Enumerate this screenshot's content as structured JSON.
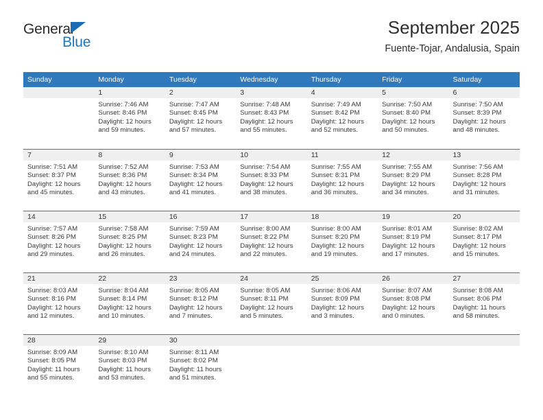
{
  "brand": {
    "name_part1": "General",
    "name_part2": "Blue",
    "triangle_color": "#1c6cb5",
    "blue_color": "#1878c4"
  },
  "header": {
    "title": "September 2025",
    "subtitle": "Fuente-Tojar, Andalusia, Spain"
  },
  "theme": {
    "header_row_bg": "#2f79bc",
    "daynum_band_bg": "#efefef",
    "separator_color": "#2f79bc",
    "text_color": "#3a3a3a"
  },
  "weekday_headers": [
    "Sunday",
    "Monday",
    "Tuesday",
    "Wednesday",
    "Thursday",
    "Friday",
    "Saturday"
  ],
  "weeks": [
    [
      {
        "day": "",
        "empty": true,
        "sunrise": "",
        "sunset": "",
        "daylight_line1": "",
        "daylight_line2": ""
      },
      {
        "day": "1",
        "empty": false,
        "sunrise": "Sunrise: 7:46 AM",
        "sunset": "Sunset: 8:46 PM",
        "daylight_line1": "Daylight: 12 hours",
        "daylight_line2": "and 59 minutes."
      },
      {
        "day": "2",
        "empty": false,
        "sunrise": "Sunrise: 7:47 AM",
        "sunset": "Sunset: 8:45 PM",
        "daylight_line1": "Daylight: 12 hours",
        "daylight_line2": "and 57 minutes."
      },
      {
        "day": "3",
        "empty": false,
        "sunrise": "Sunrise: 7:48 AM",
        "sunset": "Sunset: 8:43 PM",
        "daylight_line1": "Daylight: 12 hours",
        "daylight_line2": "and 55 minutes."
      },
      {
        "day": "4",
        "empty": false,
        "sunrise": "Sunrise: 7:49 AM",
        "sunset": "Sunset: 8:42 PM",
        "daylight_line1": "Daylight: 12 hours",
        "daylight_line2": "and 52 minutes."
      },
      {
        "day": "5",
        "empty": false,
        "sunrise": "Sunrise: 7:50 AM",
        "sunset": "Sunset: 8:40 PM",
        "daylight_line1": "Daylight: 12 hours",
        "daylight_line2": "and 50 minutes."
      },
      {
        "day": "6",
        "empty": false,
        "sunrise": "Sunrise: 7:50 AM",
        "sunset": "Sunset: 8:39 PM",
        "daylight_line1": "Daylight: 12 hours",
        "daylight_line2": "and 48 minutes."
      }
    ],
    [
      {
        "day": "7",
        "empty": false,
        "sunrise": "Sunrise: 7:51 AM",
        "sunset": "Sunset: 8:37 PM",
        "daylight_line1": "Daylight: 12 hours",
        "daylight_line2": "and 45 minutes."
      },
      {
        "day": "8",
        "empty": false,
        "sunrise": "Sunrise: 7:52 AM",
        "sunset": "Sunset: 8:36 PM",
        "daylight_line1": "Daylight: 12 hours",
        "daylight_line2": "and 43 minutes."
      },
      {
        "day": "9",
        "empty": false,
        "sunrise": "Sunrise: 7:53 AM",
        "sunset": "Sunset: 8:34 PM",
        "daylight_line1": "Daylight: 12 hours",
        "daylight_line2": "and 41 minutes."
      },
      {
        "day": "10",
        "empty": false,
        "sunrise": "Sunrise: 7:54 AM",
        "sunset": "Sunset: 8:33 PM",
        "daylight_line1": "Daylight: 12 hours",
        "daylight_line2": "and 38 minutes."
      },
      {
        "day": "11",
        "empty": false,
        "sunrise": "Sunrise: 7:55 AM",
        "sunset": "Sunset: 8:31 PM",
        "daylight_line1": "Daylight: 12 hours",
        "daylight_line2": "and 36 minutes."
      },
      {
        "day": "12",
        "empty": false,
        "sunrise": "Sunrise: 7:55 AM",
        "sunset": "Sunset: 8:29 PM",
        "daylight_line1": "Daylight: 12 hours",
        "daylight_line2": "and 34 minutes."
      },
      {
        "day": "13",
        "empty": false,
        "sunrise": "Sunrise: 7:56 AM",
        "sunset": "Sunset: 8:28 PM",
        "daylight_line1": "Daylight: 12 hours",
        "daylight_line2": "and 31 minutes."
      }
    ],
    [
      {
        "day": "14",
        "empty": false,
        "sunrise": "Sunrise: 7:57 AM",
        "sunset": "Sunset: 8:26 PM",
        "daylight_line1": "Daylight: 12 hours",
        "daylight_line2": "and 29 minutes."
      },
      {
        "day": "15",
        "empty": false,
        "sunrise": "Sunrise: 7:58 AM",
        "sunset": "Sunset: 8:25 PM",
        "daylight_line1": "Daylight: 12 hours",
        "daylight_line2": "and 26 minutes."
      },
      {
        "day": "16",
        "empty": false,
        "sunrise": "Sunrise: 7:59 AM",
        "sunset": "Sunset: 8:23 PM",
        "daylight_line1": "Daylight: 12 hours",
        "daylight_line2": "and 24 minutes."
      },
      {
        "day": "17",
        "empty": false,
        "sunrise": "Sunrise: 8:00 AM",
        "sunset": "Sunset: 8:22 PM",
        "daylight_line1": "Daylight: 12 hours",
        "daylight_line2": "and 22 minutes."
      },
      {
        "day": "18",
        "empty": false,
        "sunrise": "Sunrise: 8:00 AM",
        "sunset": "Sunset: 8:20 PM",
        "daylight_line1": "Daylight: 12 hours",
        "daylight_line2": "and 19 minutes."
      },
      {
        "day": "19",
        "empty": false,
        "sunrise": "Sunrise: 8:01 AM",
        "sunset": "Sunset: 8:19 PM",
        "daylight_line1": "Daylight: 12 hours",
        "daylight_line2": "and 17 minutes."
      },
      {
        "day": "20",
        "empty": false,
        "sunrise": "Sunrise: 8:02 AM",
        "sunset": "Sunset: 8:17 PM",
        "daylight_line1": "Daylight: 12 hours",
        "daylight_line2": "and 15 minutes."
      }
    ],
    [
      {
        "day": "21",
        "empty": false,
        "sunrise": "Sunrise: 8:03 AM",
        "sunset": "Sunset: 8:16 PM",
        "daylight_line1": "Daylight: 12 hours",
        "daylight_line2": "and 12 minutes."
      },
      {
        "day": "22",
        "empty": false,
        "sunrise": "Sunrise: 8:04 AM",
        "sunset": "Sunset: 8:14 PM",
        "daylight_line1": "Daylight: 12 hours",
        "daylight_line2": "and 10 minutes."
      },
      {
        "day": "23",
        "empty": false,
        "sunrise": "Sunrise: 8:05 AM",
        "sunset": "Sunset: 8:12 PM",
        "daylight_line1": "Daylight: 12 hours",
        "daylight_line2": "and 7 minutes."
      },
      {
        "day": "24",
        "empty": false,
        "sunrise": "Sunrise: 8:05 AM",
        "sunset": "Sunset: 8:11 PM",
        "daylight_line1": "Daylight: 12 hours",
        "daylight_line2": "and 5 minutes."
      },
      {
        "day": "25",
        "empty": false,
        "sunrise": "Sunrise: 8:06 AM",
        "sunset": "Sunset: 8:09 PM",
        "daylight_line1": "Daylight: 12 hours",
        "daylight_line2": "and 3 minutes."
      },
      {
        "day": "26",
        "empty": false,
        "sunrise": "Sunrise: 8:07 AM",
        "sunset": "Sunset: 8:08 PM",
        "daylight_line1": "Daylight: 12 hours",
        "daylight_line2": "and 0 minutes."
      },
      {
        "day": "27",
        "empty": false,
        "sunrise": "Sunrise: 8:08 AM",
        "sunset": "Sunset: 8:06 PM",
        "daylight_line1": "Daylight: 11 hours",
        "daylight_line2": "and 58 minutes."
      }
    ],
    [
      {
        "day": "28",
        "empty": false,
        "sunrise": "Sunrise: 8:09 AM",
        "sunset": "Sunset: 8:05 PM",
        "daylight_line1": "Daylight: 11 hours",
        "daylight_line2": "and 55 minutes."
      },
      {
        "day": "29",
        "empty": false,
        "sunrise": "Sunrise: 8:10 AM",
        "sunset": "Sunset: 8:03 PM",
        "daylight_line1": "Daylight: 11 hours",
        "daylight_line2": "and 53 minutes."
      },
      {
        "day": "30",
        "empty": false,
        "sunrise": "Sunrise: 8:11 AM",
        "sunset": "Sunset: 8:02 PM",
        "daylight_line1": "Daylight: 11 hours",
        "daylight_line2": "and 51 minutes."
      },
      {
        "day": "",
        "empty": true,
        "sunrise": "",
        "sunset": "",
        "daylight_line1": "",
        "daylight_line2": ""
      },
      {
        "day": "",
        "empty": true,
        "sunrise": "",
        "sunset": "",
        "daylight_line1": "",
        "daylight_line2": ""
      },
      {
        "day": "",
        "empty": true,
        "sunrise": "",
        "sunset": "",
        "daylight_line1": "",
        "daylight_line2": ""
      },
      {
        "day": "",
        "empty": true,
        "sunrise": "",
        "sunset": "",
        "daylight_line1": "",
        "daylight_line2": ""
      }
    ]
  ]
}
